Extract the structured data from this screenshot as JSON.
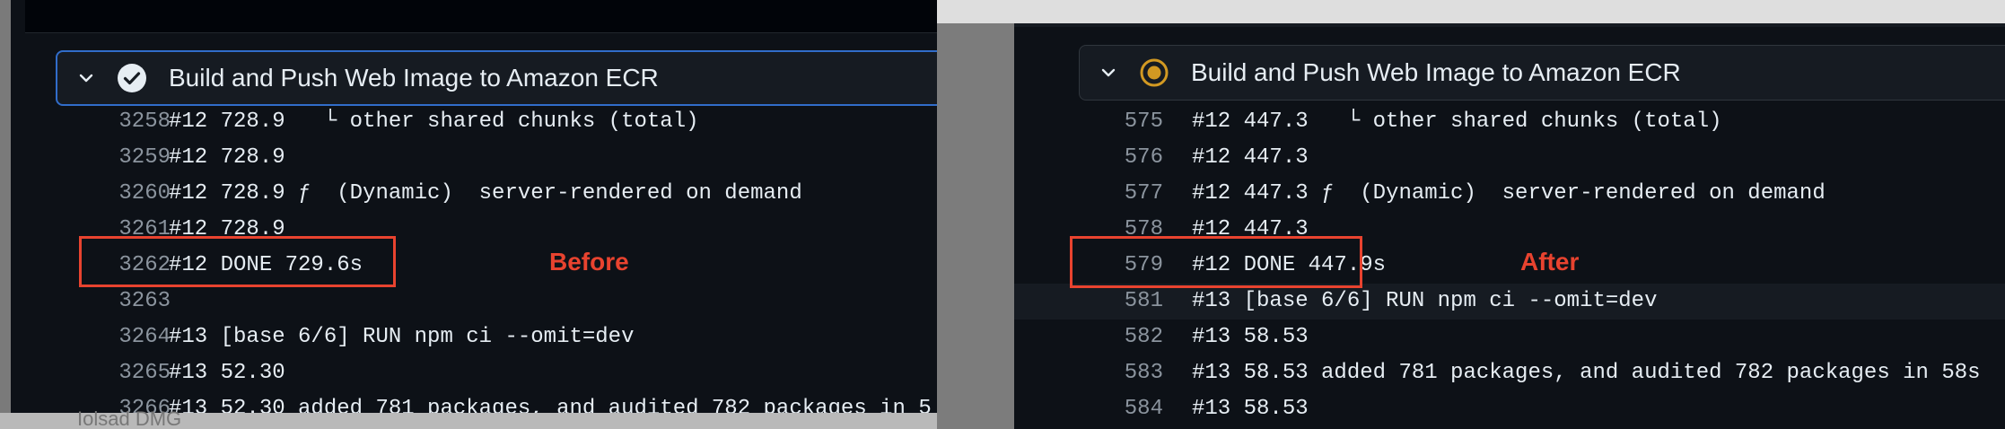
{
  "left_panel": {
    "step_title": "Build and Push Web Image to Amazon ECR",
    "status": "success",
    "annotation": "Before",
    "taskbar_ghost": "Iolsad DMG",
    "lines": [
      {
        "num": "3258",
        "text": "#12 728.9   └ other shared chunks (total)"
      },
      {
        "num": "3259",
        "text": "#12 728.9"
      },
      {
        "num": "3260",
        "text": "#12 728.9 ƒ  (Dynamic)  server-rendered on demand"
      },
      {
        "num": "3261",
        "text": "#12 728.9"
      },
      {
        "num": "3262",
        "text": "#12 DONE 729.6s"
      },
      {
        "num": "3263",
        "text": ""
      },
      {
        "num": "3264",
        "text": "#13 [base 6/6] RUN npm ci --omit=dev"
      },
      {
        "num": "3265",
        "text": "#13 52.30"
      },
      {
        "num": "3266",
        "text": "#13 52.30 added 781 packages, and audited 782 packages in 5"
      }
    ]
  },
  "right_panel": {
    "step_title": "Build and Push Web Image to Amazon ECR",
    "status": "in-progress",
    "annotation": "After",
    "lines": [
      {
        "num": "575",
        "text": "#12 447.3   └ other shared chunks (total)"
      },
      {
        "num": "576",
        "text": "#12 447.3"
      },
      {
        "num": "577",
        "text": "#12 447.3 ƒ  (Dynamic)  server-rendered on demand"
      },
      {
        "num": "578",
        "text": "#12 447.3"
      },
      {
        "num": "579",
        "text": "#12 DONE 447.9s"
      },
      {
        "num": "581",
        "text": "#13 [base 6/6] RUN npm ci --omit=dev"
      },
      {
        "num": "582",
        "text": "#13 58.53"
      },
      {
        "num": "583",
        "text": "#13 58.53 added 781 packages, and audited 782 packages in 58s"
      },
      {
        "num": "584",
        "text": "#13 58.53"
      }
    ]
  },
  "icons": {
    "expand": "chevron-down-icon",
    "success": "check-circle-icon",
    "running": "in-progress-icon"
  },
  "colors": {
    "background": "#0d1117",
    "header_bg": "#161b22",
    "focus_border": "#316dca",
    "annotation": "#e8432f",
    "running": "#d29922",
    "line_number": "#8b949e",
    "text": "#e6edf3"
  }
}
